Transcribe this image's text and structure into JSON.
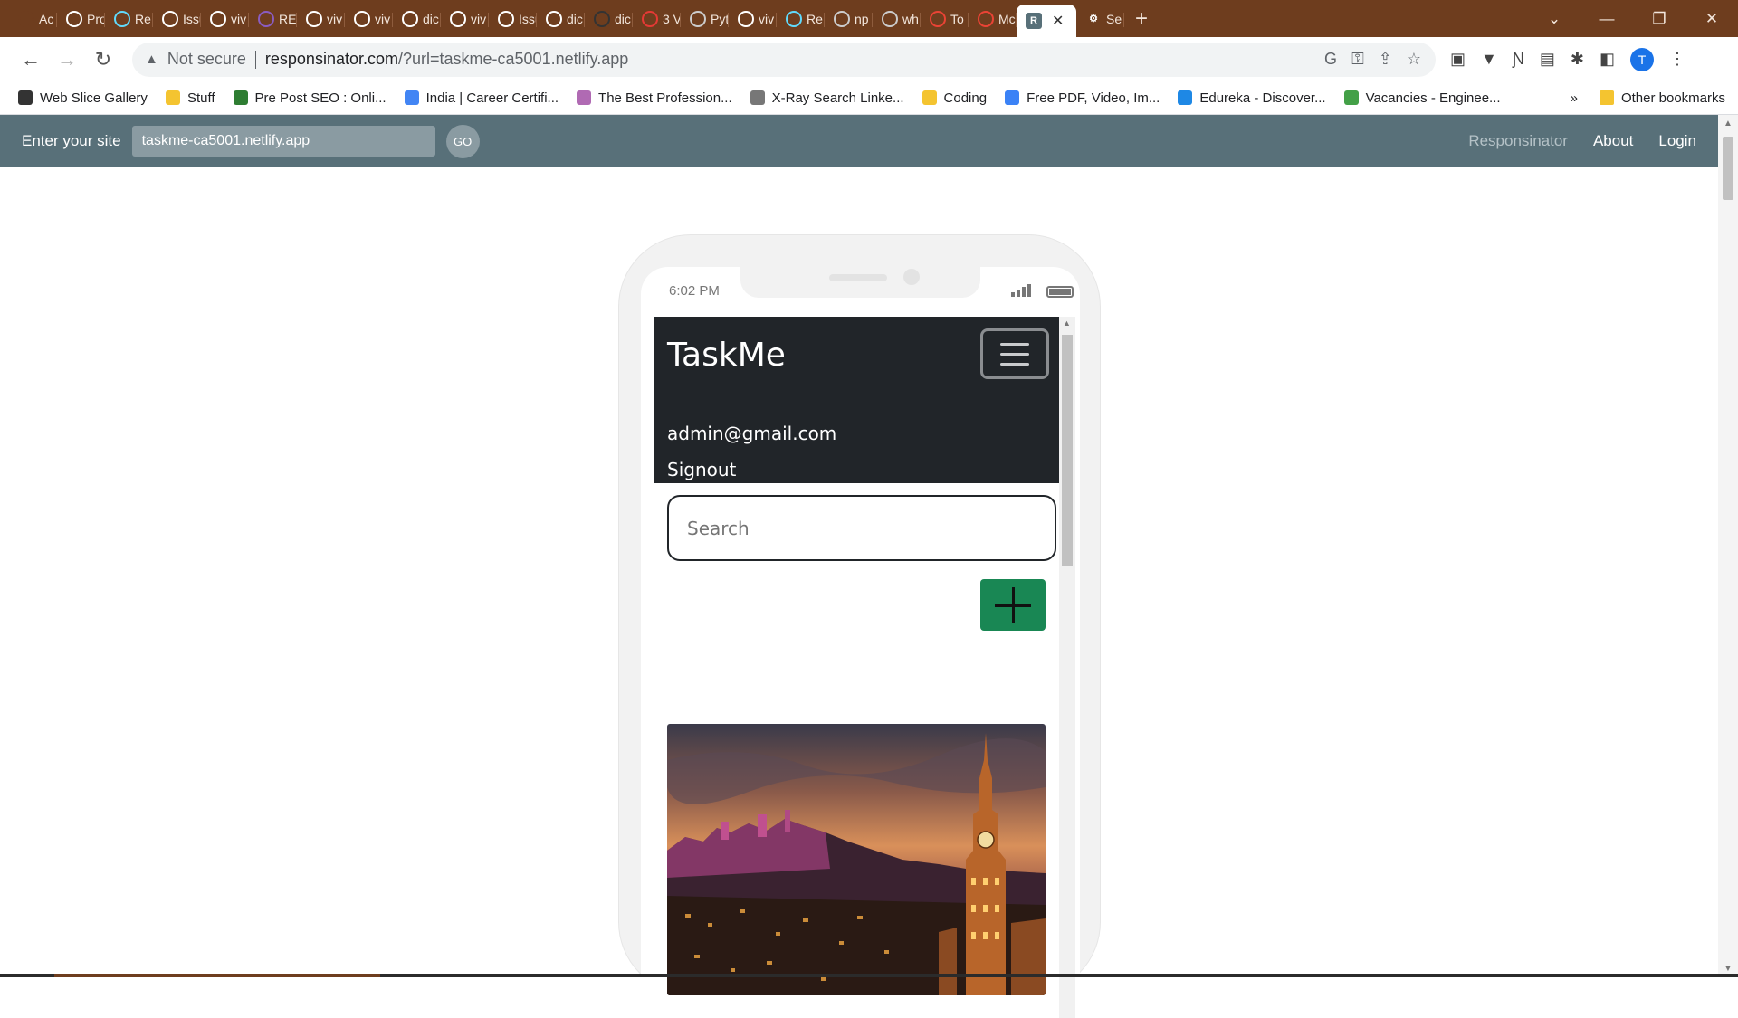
{
  "browser": {
    "tabs": [
      {
        "label": "Ac",
        "icon": "tab-app-icon",
        "color": "#6e3d1e"
      },
      {
        "label": "Pro",
        "icon": "github-icon",
        "color": "#ffffff"
      },
      {
        "label": "Re",
        "icon": "react-icon",
        "color": "#61dafb"
      },
      {
        "label": "Issu",
        "icon": "github-icon",
        "color": "#ffffff"
      },
      {
        "label": "viv",
        "icon": "github-icon",
        "color": "#ffffff"
      },
      {
        "label": "RE",
        "icon": "redux-icon",
        "color": "#8a5cc0"
      },
      {
        "label": "viv",
        "icon": "github-icon",
        "color": "#ffffff"
      },
      {
        "label": "viv",
        "icon": "github-icon",
        "color": "#ffffff"
      },
      {
        "label": "dic",
        "icon": "github-icon",
        "color": "#ffffff"
      },
      {
        "label": "viv",
        "icon": "github-icon",
        "color": "#ffffff"
      },
      {
        "label": "Issu",
        "icon": "github-icon",
        "color": "#ffffff"
      },
      {
        "label": "dic",
        "icon": "github-icon",
        "color": "#ffffff"
      },
      {
        "label": "dic",
        "icon": "github-icon",
        "color": "#333333"
      },
      {
        "label": "3 V",
        "icon": "video-icon",
        "color": "#e53935"
      },
      {
        "label": "Pyt",
        "icon": "globe-icon",
        "color": "#cccccc"
      },
      {
        "label": "viv",
        "icon": "github-icon",
        "color": "#ffffff"
      },
      {
        "label": "Re",
        "icon": "react-icon",
        "color": "#61dafb"
      },
      {
        "label": "np",
        "icon": "globe-icon",
        "color": "#cccccc"
      },
      {
        "label": "wh",
        "icon": "globe-icon",
        "color": "#cccccc"
      },
      {
        "label": "To",
        "icon": "google-icon",
        "color": "#ea4335"
      },
      {
        "label": "Mc",
        "icon": "google-icon",
        "color": "#ea4335"
      }
    ],
    "active_tab": {
      "label": "R",
      "close": "✕"
    },
    "last_tab": {
      "label": "Se",
      "icon": "gear-icon"
    },
    "new_tab": "+",
    "window_controls": {
      "menu": "⌄",
      "minimize": "—",
      "restore": "❐",
      "close": "✕"
    },
    "nav": {
      "back": "←",
      "forward": "→",
      "reload": "↻"
    },
    "address": {
      "security": "Not secure",
      "domain": "responsinator.com",
      "path": "/?url=taskme-ca5001.netlify.app"
    },
    "profile_initial": "T",
    "bookmarks": [
      {
        "label": "Web Slice Gallery",
        "color": "#333333"
      },
      {
        "label": "Stuff",
        "color": "#f4c430"
      },
      {
        "label": "Pre Post SEO : Onli...",
        "color": "#2e7d32"
      },
      {
        "label": "India | Career Certifi...",
        "color": "#4285f4"
      },
      {
        "label": "The Best Profession...",
        "color": "#b06ab3"
      },
      {
        "label": "X-Ray Search Linke...",
        "color": "#777777"
      },
      {
        "label": "Coding",
        "color": "#f4c430"
      },
      {
        "label": "Free PDF, Video, Im...",
        "color": "#3b82f6"
      },
      {
        "label": "Edureka - Discover...",
        "color": "#1e88e5"
      },
      {
        "label": "Vacancies - Enginee...",
        "color": "#43a047"
      }
    ],
    "bookmarks_more": "»",
    "other_bookmarks": "Other bookmarks"
  },
  "responsinator": {
    "label": "Enter your site",
    "site_value": "taskme-ca5001.netlify.app",
    "go": "GO",
    "links": [
      "Responsinator",
      "About",
      "Login"
    ]
  },
  "device": {
    "time": "6:02 PM"
  },
  "app": {
    "brand": "TaskMe",
    "user_email": "admin@gmail.com",
    "signout": "Signout",
    "search_placeholder": "Search",
    "accent": "#198754",
    "navbar_color": "#212529"
  }
}
